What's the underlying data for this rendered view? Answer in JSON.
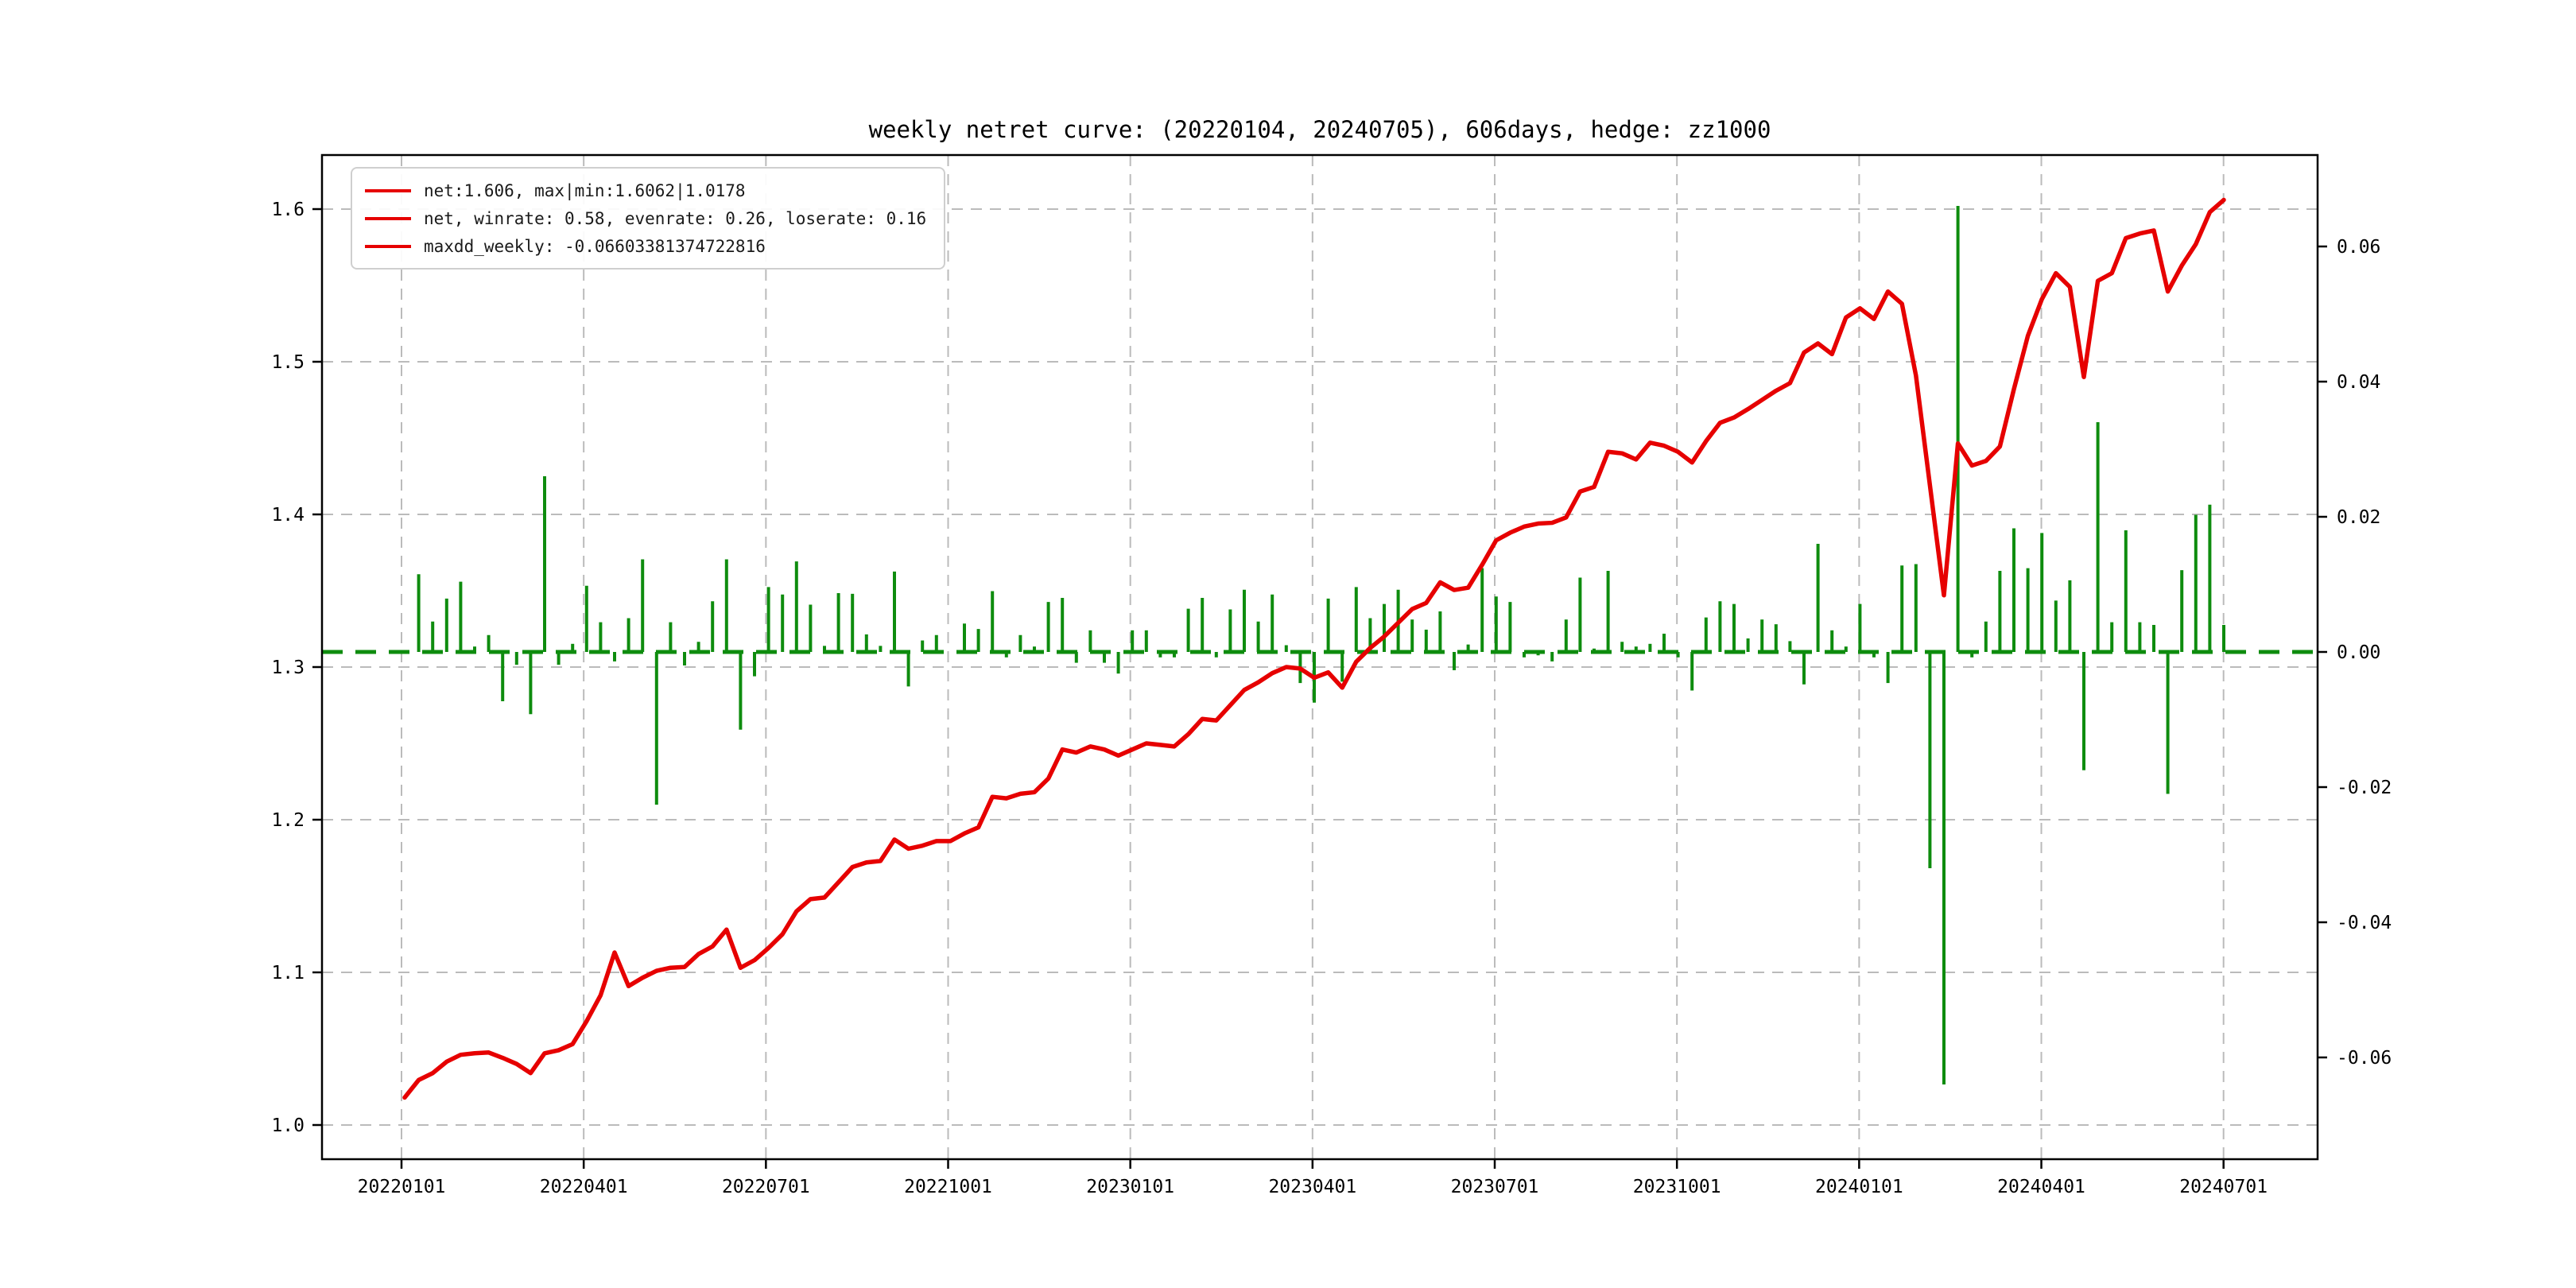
{
  "chart_data": {
    "type": "line+bar",
    "title": "weekly netret curve: (20220104, 20240705), 606days, hedge: zz1000",
    "legend_labels": [
      "net:1.606, max|min:1.6062|1.0178",
      "net, winrate: 0.58, evenrate: 0.26, loserate: 0.16",
      "maxdd_weekly: -0.06603381374722816"
    ],
    "colors": {
      "net_line": "#e60000",
      "bars": "#0e8c0e",
      "zero_line": "#0e8c0e",
      "grid": "#bbbbbb",
      "spine": "#000000",
      "text": "#000000"
    },
    "left_axis": {
      "label_ticks": [
        "1.0",
        "1.1",
        "1.2",
        "1.3",
        "1.4",
        "1.5",
        "1.6"
      ],
      "tick_values": [
        1.0,
        1.1,
        1.2,
        1.3,
        1.4,
        1.5,
        1.6
      ],
      "range_note": "net value"
    },
    "right_axis": {
      "label_ticks": [
        "-0.06",
        "-0.04",
        "-0.02",
        "0.00",
        "0.02",
        "0.04",
        "0.06"
      ],
      "tick_values": [
        -0.06,
        -0.04,
        -0.02,
        0.0,
        0.02,
        0.04,
        0.06
      ],
      "range_note": "weekly return"
    },
    "x_axis": {
      "tick_labels": [
        "20220101",
        "20220401",
        "20220701",
        "20221001",
        "20230101",
        "20230401",
        "20230701",
        "20231001",
        "20240101",
        "20240401",
        "20240701"
      ],
      "start_date": "20220104",
      "end_date": "20240705",
      "weeks": 131
    },
    "grid": "dashed, on both x quarter ticks and left-axis ticks",
    "legend_position": "upper left",
    "series": [
      {
        "name": "net",
        "axis": "left",
        "style": "red solid line",
        "values": [
          1.018,
          1.0295,
          1.034,
          1.0415,
          1.046,
          1.047,
          1.0475,
          1.044,
          1.04,
          1.034,
          1.047,
          1.049,
          1.053,
          1.068,
          1.085,
          1.113,
          1.091,
          1.0965,
          1.101,
          1.103,
          1.1035,
          1.112,
          1.117,
          1.128,
          1.103,
          1.108,
          1.116,
          1.125,
          1.14,
          1.148,
          1.149,
          1.159,
          1.169,
          1.172,
          1.173,
          1.187,
          1.181,
          1.183,
          1.186,
          1.186,
          1.191,
          1.195,
          1.215,
          1.214,
          1.217,
          1.218,
          1.227,
          1.246,
          1.244,
          1.248,
          1.246,
          1.242,
          1.246,
          1.25,
          1.249,
          1.248,
          1.256,
          1.266,
          1.265,
          1.275,
          1.285,
          1.29,
          1.296,
          1.3,
          1.299,
          1.293,
          1.2965,
          1.2865,
          1.3035,
          1.3125,
          1.32,
          1.329,
          1.338,
          1.342,
          1.3555,
          1.3505,
          1.352,
          1.367,
          1.383,
          1.388,
          1.392,
          1.394,
          1.3945,
          1.398,
          1.415,
          1.418,
          1.441,
          1.44,
          1.436,
          1.447,
          1.445,
          1.441,
          1.434,
          1.448,
          1.46,
          1.4635,
          1.469,
          1.475,
          1.481,
          1.486,
          1.506,
          1.512,
          1.505,
          1.529,
          1.535,
          1.528,
          1.546,
          1.538,
          1.491,
          1.419,
          1.347,
          1.4465,
          1.432,
          1.435,
          1.4445,
          1.482,
          1.517,
          1.541,
          1.558,
          1.549,
          1.49,
          1.553,
          1.558,
          1.581,
          1.584,
          1.586,
          1.546,
          1.563,
          1.577,
          1.598,
          1.606
        ]
      },
      {
        "name": "weekly_return",
        "axis": "right",
        "style": "green bars with dashed zero line",
        "values": [
          0.0,
          0.0115,
          0.0045,
          0.0079,
          0.0104,
          0.0008,
          0.0025,
          -0.0073,
          -0.0019,
          -0.0092,
          0.026,
          -0.0019,
          0.0012,
          0.0098,
          0.0044,
          -0.0014,
          0.005,
          0.0137,
          -0.0226,
          0.0044,
          -0.002,
          0.0015,
          0.0075,
          0.0137,
          -0.0115,
          -0.0036,
          0.0096,
          0.0085,
          0.0134,
          0.007,
          0.0009,
          0.0087,
          0.0086,
          0.0026,
          0.0009,
          0.0119,
          -0.0051,
          0.0017,
          0.0025,
          0.0,
          0.0042,
          0.0034,
          0.009,
          -0.0008,
          0.0025,
          0.0008,
          0.0074,
          0.008,
          -0.0016,
          0.0032,
          -0.0016,
          -0.0032,
          0.0032,
          0.0032,
          -0.0008,
          -0.0008,
          0.0064,
          0.008,
          -0.0008,
          0.0063,
          0.0092,
          0.0045,
          0.0085,
          0.001,
          -0.0046,
          -0.0075,
          0.0079,
          -0.0044,
          0.0096,
          0.005,
          0.0071,
          0.0092,
          0.0048,
          0.0033,
          0.006,
          -0.0027,
          0.0011,
          0.0124,
          0.0082,
          0.0074,
          -0.0008,
          -0.0005,
          -0.0014,
          0.0048,
          0.011,
          0.0005,
          0.012,
          0.0015,
          0.0008,
          0.0012,
          0.0027,
          -0.0008,
          -0.0057,
          0.0051,
          0.0075,
          0.0071,
          0.002,
          0.0048,
          0.0041,
          0.0016,
          -0.0048,
          0.016,
          0.0032,
          0.0008,
          0.0071,
          -0.0008,
          -0.0046,
          0.0128,
          0.013,
          -0.032,
          -0.064,
          0.066,
          -0.0008,
          0.0045,
          0.012,
          0.0183,
          0.0124,
          0.0176,
          0.0076,
          0.0106,
          -0.0175,
          0.034,
          0.0044,
          0.018,
          0.0044,
          0.004,
          -0.021,
          0.0121,
          0.0203,
          0.0218,
          0.004
        ]
      }
    ],
    "stats": {
      "net_final": "1.606",
      "net_max": "1.6062",
      "net_min": "1.0178",
      "winrate": "0.58",
      "evenrate": "0.26",
      "loserate": "0.16",
      "maxdd_weekly": "-0.06603381374722816"
    }
  },
  "layout_hint": {
    "plot_left": 405,
    "plot_top": 195,
    "plot_right": 2915,
    "plot_bottom": 1458
  }
}
